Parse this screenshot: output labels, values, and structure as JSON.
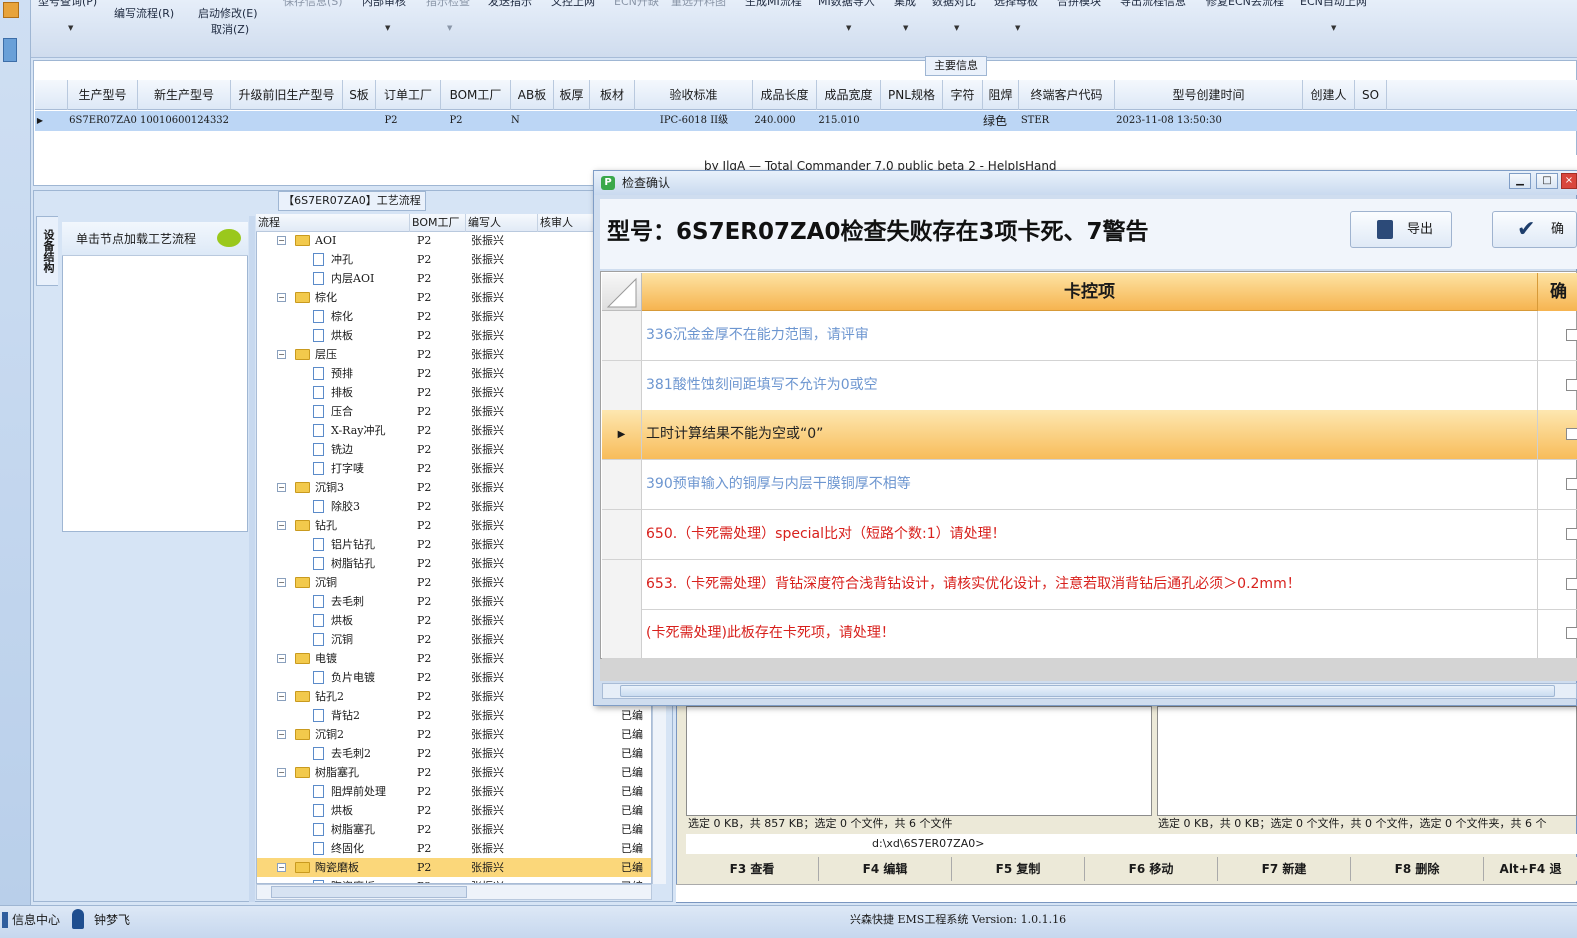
{
  "toolbar": {
    "top_items": [
      "型号查询(P)",
      "保存信息(S)",
      "内部审核",
      "指示检查",
      "发送指示",
      "文控上网",
      "ECN开缺",
      "童选开料图",
      "生成MI流程",
      "MI数据导入",
      "集成",
      "数据对比",
      "选择母板",
      "合拼模块",
      "导出流程信息",
      "修复ECN丢流程",
      "ECN自动上网"
    ],
    "write_flow": "编写流程(R)",
    "start_modify": "启动修改(E)",
    "cancel": "取消(Z)"
  },
  "main_info": {
    "label": "主要信息",
    "columns": [
      "生产型号",
      "新生产型号",
      "升级前旧生产型号",
      "S板",
      "订单工厂",
      "BOM工厂",
      "AB板",
      "板厚",
      "板材",
      "验收标准",
      "成品长度",
      "成品宽度",
      "PNL规格",
      "字符",
      "阻焊",
      "终端客户代码",
      "型号创建时间",
      "创建人",
      "SO"
    ],
    "row": {
      "生产型号": "6S7ER07ZA0",
      "新生产型号": "10010600124332",
      "订单工厂": "P2",
      "BOM工厂": "P2",
      "AB板": "N",
      "验收标准": "IPC-6018 II级",
      "成品长度": "240.000",
      "成品宽度": "215.010",
      "阻焊": "绿色",
      "终端客户代码": "STER",
      "型号创建时间": "2023-11-08 13:50:30"
    }
  },
  "process": {
    "label": "【6S7ER07ZA0】工艺流程",
    "side_tab": "设备结构",
    "hint": "单击节点加载工艺流程",
    "columns": [
      "流程",
      "BOM工厂",
      "编写人",
      "核审人"
    ],
    "rows": [
      {
        "name": "AOI",
        "type": "folder",
        "factory": "P2",
        "author": "张振兴",
        "edit": ""
      },
      {
        "name": "冲孔",
        "type": "doc",
        "factory": "P2",
        "author": "张振兴",
        "edit": ""
      },
      {
        "name": "内层AOI",
        "type": "doc",
        "factory": "P2",
        "author": "张振兴",
        "edit": ""
      },
      {
        "name": "棕化",
        "type": "folder",
        "factory": "P2",
        "author": "张振兴",
        "edit": ""
      },
      {
        "name": "棕化",
        "type": "doc",
        "factory": "P2",
        "author": "张振兴",
        "edit": ""
      },
      {
        "name": "烘板",
        "type": "doc",
        "factory": "P2",
        "author": "张振兴",
        "edit": ""
      },
      {
        "name": "层压",
        "type": "folder",
        "factory": "P2",
        "author": "张振兴",
        "edit": ""
      },
      {
        "name": "预排",
        "type": "doc",
        "factory": "P2",
        "author": "张振兴",
        "edit": ""
      },
      {
        "name": "排板",
        "type": "doc",
        "factory": "P2",
        "author": "张振兴",
        "edit": ""
      },
      {
        "name": "压合",
        "type": "doc",
        "factory": "P2",
        "author": "张振兴",
        "edit": ""
      },
      {
        "name": "X-Ray冲孔",
        "type": "doc",
        "factory": "P2",
        "author": "张振兴",
        "edit": ""
      },
      {
        "name": "铣边",
        "type": "doc",
        "factory": "P2",
        "author": "张振兴",
        "edit": ""
      },
      {
        "name": "打字唛",
        "type": "doc",
        "factory": "P2",
        "author": "张振兴",
        "edit": ""
      },
      {
        "name": "沉铜3",
        "type": "folder",
        "factory": "P2",
        "author": "张振兴",
        "edit": ""
      },
      {
        "name": "除胶3",
        "type": "doc",
        "factory": "P2",
        "author": "张振兴",
        "edit": ""
      },
      {
        "name": "钻孔",
        "type": "folder",
        "factory": "P2",
        "author": "张振兴",
        "edit": ""
      },
      {
        "name": "铝片钻孔",
        "type": "doc",
        "factory": "P2",
        "author": "张振兴",
        "edit": ""
      },
      {
        "name": "树脂钻孔",
        "type": "doc",
        "factory": "P2",
        "author": "张振兴",
        "edit": ""
      },
      {
        "name": "沉铜",
        "type": "folder",
        "factory": "P2",
        "author": "张振兴",
        "edit": ""
      },
      {
        "name": "去毛刺",
        "type": "doc",
        "factory": "P2",
        "author": "张振兴",
        "edit": ""
      },
      {
        "name": "烘板",
        "type": "doc",
        "factory": "P2",
        "author": "张振兴",
        "edit": ""
      },
      {
        "name": "沉铜",
        "type": "doc",
        "factory": "P2",
        "author": "张振兴",
        "edit": ""
      },
      {
        "name": "电镀",
        "type": "folder",
        "factory": "P2",
        "author": "张振兴",
        "edit": ""
      },
      {
        "name": "负片电镀",
        "type": "doc",
        "factory": "P2",
        "author": "张振兴",
        "edit": ""
      },
      {
        "name": "钻孔2",
        "type": "folder",
        "factory": "P2",
        "author": "张振兴",
        "edit": ""
      },
      {
        "name": "背钻2",
        "type": "doc",
        "factory": "P2",
        "author": "张振兴",
        "edit": "已编"
      },
      {
        "name": "沉铜2",
        "type": "folder",
        "factory": "P2",
        "author": "张振兴",
        "edit": "已编"
      },
      {
        "name": "去毛刺2",
        "type": "doc",
        "factory": "P2",
        "author": "张振兴",
        "edit": "已编"
      },
      {
        "name": "树脂塞孔",
        "type": "folder",
        "factory": "P2",
        "author": "张振兴",
        "edit": "已编"
      },
      {
        "name": "阻焊前处理",
        "type": "doc",
        "factory": "P2",
        "author": "张振兴",
        "edit": "已编"
      },
      {
        "name": "烘板",
        "type": "doc",
        "factory": "P2",
        "author": "张振兴",
        "edit": "已编"
      },
      {
        "name": "树脂塞孔",
        "type": "doc",
        "factory": "P2",
        "author": "张振兴",
        "edit": "已编"
      },
      {
        "name": "终固化",
        "type": "doc",
        "factory": "P2",
        "author": "张振兴",
        "edit": "已编"
      },
      {
        "name": "陶瓷磨板",
        "type": "folder",
        "factory": "P2",
        "author": "张振兴",
        "edit": "已编",
        "selected": true
      },
      {
        "name": "陶瓷磨板",
        "type": "doc",
        "factory": "P2",
        "author": "张振兴",
        "edit": "已编"
      }
    ]
  },
  "tc": {
    "title": "by JlgA — Total Commander 7.0 public beta 2 - HelpIsHand",
    "status_left": "选定 0 KB，共 857 KB；选定 0 个文件，共 6 个文件",
    "status_right": "选定 0 KB，共 0 KB；选定 0 个文件，共 0 个文件，选定 0 个文件夹，共 6 个",
    "path": "d:\\xd\\6S7ER07ZA0>",
    "fkeys": [
      "F3 查看",
      "F4 编辑",
      "F5 复制",
      "F6 移动",
      "F7 新建",
      "F8 删除",
      "Alt+F4 退"
    ]
  },
  "dialog": {
    "title": "检查确认",
    "heading": "型号：6S7ER07ZA0检查失败存在3项卡死、7警告",
    "export_label": "导出",
    "confirm_label": "确定",
    "column_header": "卡控项",
    "column_header2": "确",
    "rows": [
      {
        "text": "336沉金金厚不在能力范围，请评审",
        "level": "warn"
      },
      {
        "text": "381酸性蚀刻间距填写不允许为0或空",
        "level": "warn"
      },
      {
        "text": "工时计算结果不能为空或“0”",
        "level": "normal",
        "selected": true
      },
      {
        "text": "390预审输入的铜厚与内层干膜铜厚不相等",
        "level": "warn"
      },
      {
        "text": "650.（卡死需处理）special比对（短路个数:1）请处理！",
        "level": "block"
      },
      {
        "text": "653.（卡死需处理）背钻深度符合浅背钻设计，请核实优化设计，注意若取消背钻后通孔必须＞0.2mm！",
        "level": "block"
      },
      {
        "text": "(卡死需处理)此板存在卡死项，请处理！",
        "level": "block"
      }
    ],
    "colors": {
      "warn": "#6d96d0",
      "block": "#d8201c",
      "normal": "#222222",
      "header": "#f6b450"
    }
  },
  "statusbar": {
    "info_center": "信息中心",
    "user": "钟梦飞",
    "app": "兴森快捷 EMS工程系统 Version: 1.0.1.16"
  }
}
